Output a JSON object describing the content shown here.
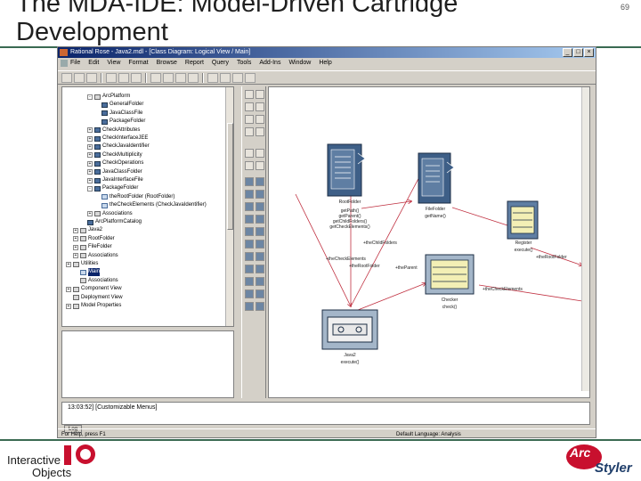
{
  "slide": {
    "title": "The MDA-IDE: Model-Driven Cartridge\nDevelopment",
    "page_number": "69"
  },
  "window": {
    "title": "Rational Rose - Java2.mdl - [Class Diagram: Logical View / Main]",
    "controls": [
      "_",
      "□",
      "×"
    ]
  },
  "menubar": {
    "items": [
      "File",
      "Edit",
      "View",
      "Format",
      "Browse",
      "Report",
      "Query",
      "Tools",
      "Add-Ins",
      "Window",
      "Help"
    ]
  },
  "browser": {
    "items": [
      {
        "label": "ArcPlatform",
        "indent": 3,
        "icon": "pkg",
        "exp": "-"
      },
      {
        "label": "GeneralFolder",
        "indent": 4,
        "icon": "cls",
        "exp": ""
      },
      {
        "label": "JavaClassFile",
        "indent": 4,
        "icon": "cls",
        "exp": ""
      },
      {
        "label": "PackageFolder",
        "indent": 4,
        "icon": "cls",
        "exp": ""
      },
      {
        "label": "CheckAttributes",
        "indent": 3,
        "icon": "cls",
        "exp": "+"
      },
      {
        "label": "CheckInterfaceJEE",
        "indent": 3,
        "icon": "cls",
        "exp": "+"
      },
      {
        "label": "CheckJavaIdentifier",
        "indent": 3,
        "icon": "cls",
        "exp": "+"
      },
      {
        "label": "CheckMultiplicity",
        "indent": 3,
        "icon": "cls",
        "exp": "+"
      },
      {
        "label": "CheckOperations",
        "indent": 3,
        "icon": "cls",
        "exp": "+"
      },
      {
        "label": "JavaClassFolder",
        "indent": 3,
        "icon": "cls",
        "exp": "+"
      },
      {
        "label": "JavaInterfaceFile",
        "indent": 3,
        "icon": "cls",
        "exp": "+"
      },
      {
        "label": "PackageFolder",
        "indent": 3,
        "icon": "cls",
        "exp": "-"
      },
      {
        "label": "theRootFolder (RootFolder)",
        "indent": 4,
        "icon": "dia",
        "exp": ""
      },
      {
        "label": "theCheckElements (CheckJavaIdentifier)",
        "indent": 4,
        "icon": "dia",
        "exp": ""
      },
      {
        "label": "Associations",
        "indent": 3,
        "icon": "pkg",
        "exp": "+"
      },
      {
        "label": "ArcPlatformCatalog",
        "indent": 2,
        "icon": "cls",
        "exp": ""
      },
      {
        "label": "Java2",
        "indent": 1,
        "icon": "pkg",
        "exp": "+"
      },
      {
        "label": "RootFolder",
        "indent": 1,
        "icon": "pkg",
        "exp": "+"
      },
      {
        "label": "FileFolder",
        "indent": 1,
        "icon": "pkg",
        "exp": "+"
      },
      {
        "label": "Associations",
        "indent": 1,
        "icon": "pkg",
        "exp": "+"
      },
      {
        "label": "Utilities",
        "indent": 0,
        "icon": "pkg",
        "exp": "+"
      },
      {
        "label": "Main",
        "indent": 1,
        "icon": "dia",
        "exp": "",
        "selected": true
      },
      {
        "label": "Associations",
        "indent": 1,
        "icon": "pkg",
        "exp": ""
      },
      {
        "label": "Component View",
        "indent": 0,
        "icon": "pkg",
        "exp": "+"
      },
      {
        "label": "Deployment View",
        "indent": 0,
        "icon": "pkg",
        "exp": ""
      },
      {
        "label": "Model Properties",
        "indent": 0,
        "icon": "pkg",
        "exp": "+"
      }
    ]
  },
  "diagram": {
    "nodes": {
      "rootfolder": {
        "name": "RootFolder",
        "ops": [
          "getPath()",
          "getParent()",
          "getChildFolders()",
          "getCheckElements()"
        ]
      },
      "filefolder": {
        "name": "FileFolder",
        "ops": [
          "getName()"
        ]
      },
      "java2": {
        "name": "Java2",
        "ops": [
          "execute()"
        ]
      },
      "checker": {
        "name": "Checker",
        "ops": [
          "check()"
        ]
      },
      "rightbox": {
        "name": "Register",
        "ops": [
          "execute()"
        ]
      }
    },
    "assoc_labels": [
      "+theChildFolders",
      "+theCheckElements",
      "+theRootFolder",
      "+theRootFolder",
      "+theParent",
      "+theCheckElements"
    ]
  },
  "log": {
    "message": "13:03:52]  [Customizable Menus]",
    "tab_label": "Log"
  },
  "status": {
    "left": "For Help, press F1",
    "right": "Default Language: Analysis"
  },
  "footer": {
    "company_line1": "Interactive",
    "company_line2": "Objects",
    "product_arc": "Arc",
    "product_styler": "Styler"
  },
  "colors": {
    "accent_rule": "#3a6a52",
    "titlebar_start": "#0a246a",
    "class_icon": "#4a6d9b",
    "arrow_red": "#c03040"
  }
}
